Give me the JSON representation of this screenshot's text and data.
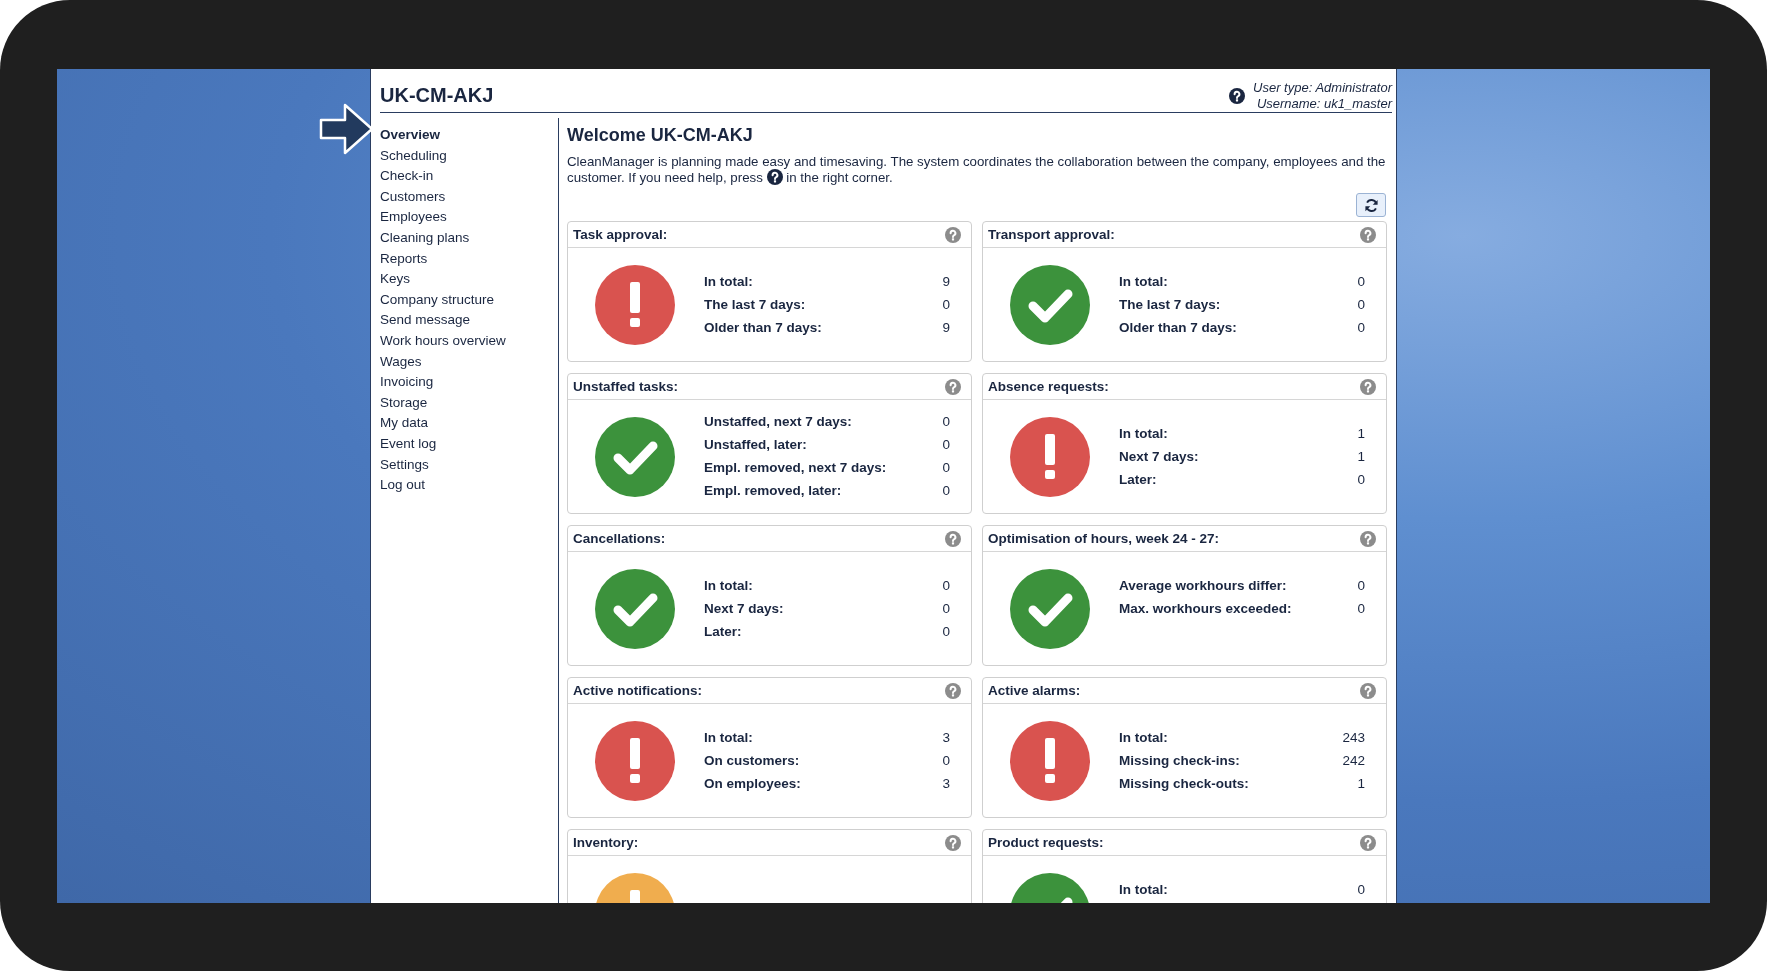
{
  "app": {
    "title": "UK-CM-AKJ",
    "user_type": "User type: Administrator",
    "username": "Username: uk1_master"
  },
  "sidebar": {
    "items": [
      {
        "label": "Overview",
        "selected": true
      },
      {
        "label": "Scheduling",
        "selected": false
      },
      {
        "label": "Check-in",
        "selected": false
      },
      {
        "label": "Customers",
        "selected": false
      },
      {
        "label": "Employees",
        "selected": false
      },
      {
        "label": "Cleaning plans",
        "selected": false
      },
      {
        "label": "Reports",
        "selected": false
      },
      {
        "label": "Keys",
        "selected": false
      },
      {
        "label": "Company structure",
        "selected": false
      },
      {
        "label": "Send message",
        "selected": false
      },
      {
        "label": "Work hours overview",
        "selected": false
      },
      {
        "label": "Wages",
        "selected": false
      },
      {
        "label": "Invoicing",
        "selected": false
      },
      {
        "label": "Storage",
        "selected": false
      },
      {
        "label": "My data",
        "selected": false
      },
      {
        "label": "Event log",
        "selected": false
      },
      {
        "label": "Settings",
        "selected": false
      },
      {
        "label": "Log out",
        "selected": false
      }
    ]
  },
  "welcome": {
    "heading": "Welcome UK-CM-AKJ",
    "text_before": "CleanManager is planning made easy and timesaving. The system coordinates the collaboration between the company, employees and the customer. If you need help, press",
    "text_after": "in the right corner."
  },
  "cards": [
    {
      "title": "Task approval:",
      "kind": "alert",
      "rows": [
        {
          "label": "In total:",
          "value": "9"
        },
        {
          "label": "The last 7 days:",
          "value": "0"
        },
        {
          "label": "Older than 7 days:",
          "value": "9"
        }
      ]
    },
    {
      "title": "Transport approval:",
      "kind": "ok",
      "rows": [
        {
          "label": "In total:",
          "value": "0"
        },
        {
          "label": "The last 7 days:",
          "value": "0"
        },
        {
          "label": "Older than 7 days:",
          "value": "0"
        }
      ]
    },
    {
      "title": "Unstaffed tasks:",
      "kind": "ok",
      "rows": [
        {
          "label": "Unstaffed, next 7 days:",
          "value": "0"
        },
        {
          "label": "Unstaffed, later:",
          "value": "0"
        },
        {
          "label": "Empl. removed, next 7 days:",
          "value": "0"
        },
        {
          "label": "Empl. removed, later:",
          "value": "0"
        }
      ]
    },
    {
      "title": "Absence requests:",
      "kind": "alert",
      "rows": [
        {
          "label": "In total:",
          "value": "1"
        },
        {
          "label": "Next 7 days:",
          "value": "1"
        },
        {
          "label": "Later:",
          "value": "0"
        }
      ]
    },
    {
      "title": "Cancellations:",
      "kind": "ok",
      "rows": [
        {
          "label": "In total:",
          "value": "0"
        },
        {
          "label": "Next 7 days:",
          "value": "0"
        },
        {
          "label": "Later:",
          "value": "0"
        }
      ]
    },
    {
      "title": "Optimisation of hours, week 24 - 27:",
      "kind": "ok",
      "rows": [
        {
          "label": "Average workhours differ:",
          "value": "0"
        },
        {
          "label": "Max. workhours exceeded:",
          "value": "0"
        }
      ]
    },
    {
      "title": "Active notifications:",
      "kind": "alert",
      "rows": [
        {
          "label": "In total:",
          "value": "3"
        },
        {
          "label": "On customers:",
          "value": "0"
        },
        {
          "label": "On employees:",
          "value": "3"
        }
      ]
    },
    {
      "title": "Active alarms:",
      "kind": "alert",
      "rows": [
        {
          "label": "In total:",
          "value": "243"
        },
        {
          "label": "Missing check-ins:",
          "value": "242"
        },
        {
          "label": "Missing check-outs:",
          "value": "1"
        }
      ]
    },
    {
      "title": "Inventory:",
      "kind": "warning"
    },
    {
      "title": "Product requests:",
      "kind": "ok",
      "rows": [
        {
          "label": "In total:",
          "value": "0"
        }
      ]
    }
  ]
}
